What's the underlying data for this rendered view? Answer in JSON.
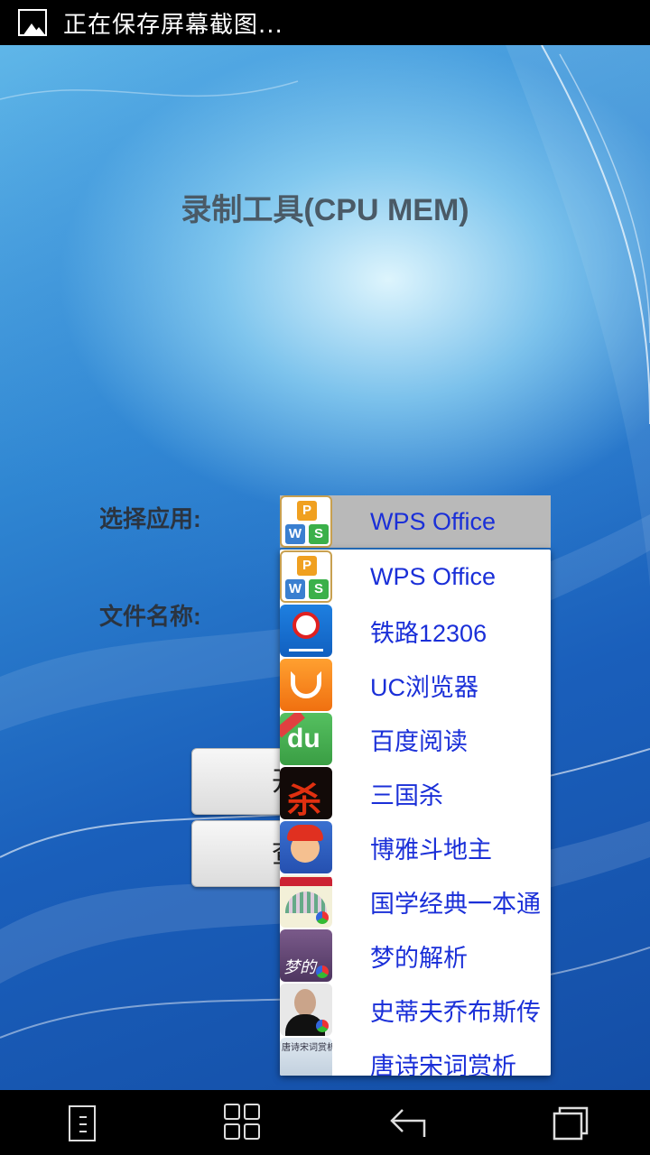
{
  "status_bar": {
    "text": "正在保存屏幕截图..."
  },
  "app": {
    "title": "录制工具(CPU MEM)",
    "select_app_label": "选择应用:",
    "file_name_label": "文件名称:",
    "start_button_partial": "开",
    "query_button_partial": "查"
  },
  "spinner": {
    "selected": {
      "label": "WPS Office",
      "icon": "wps-office-icon"
    },
    "options": [
      {
        "label": "WPS Office",
        "icon": "wps-office-icon"
      },
      {
        "label": "铁路12306",
        "icon": "railway-12306-icon"
      },
      {
        "label": "UC浏览器",
        "icon": "uc-browser-icon"
      },
      {
        "label": "百度阅读",
        "icon": "baidu-reading-icon"
      },
      {
        "label": "三国杀",
        "icon": "sanguosha-icon"
      },
      {
        "label": "博雅斗地主",
        "icon": "boya-doudizhu-icon"
      },
      {
        "label": "国学经典一本通",
        "icon": "guoxue-classics-icon"
      },
      {
        "label": "梦的解析",
        "icon": "dream-interpretation-icon"
      },
      {
        "label": "史蒂夫乔布斯传",
        "icon": "steve-jobs-biography-icon"
      },
      {
        "label": "唐诗宋词赏析",
        "icon": "tang-poems-icon"
      }
    ]
  },
  "icon_text": {
    "wps": [
      "P",
      "W",
      "S"
    ],
    "du": "du",
    "sgs": "杀",
    "dream": "梦的",
    "poem": "唐诗宋词赏析"
  },
  "nav_bar": {
    "buttons": [
      "menu-icon",
      "home-icon",
      "back-icon",
      "recent-apps-icon"
    ]
  },
  "colors": {
    "option_text": "#1a2fd8",
    "spinner_selected_bg": "#b9b9b9",
    "title_text": "#4a5a66"
  }
}
